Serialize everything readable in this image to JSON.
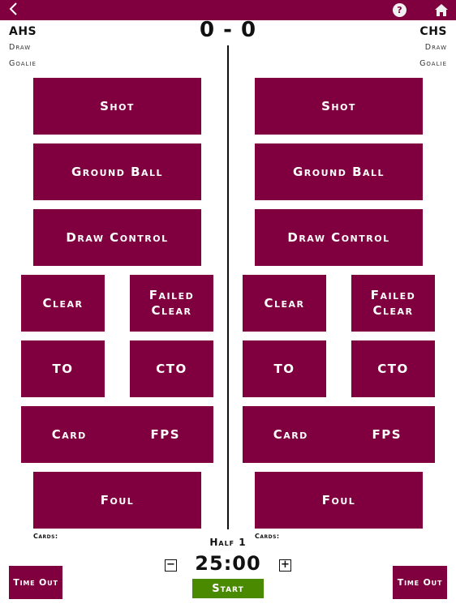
{
  "header": {
    "back_icon": "chevron-left-icon",
    "help_icon": "question-bubble-icon",
    "help_glyph": "?",
    "home_icon": "home-icon",
    "bar_color": "#80003f"
  },
  "scoreboard": {
    "home_team": "AHS",
    "away_team": "CHS",
    "score": "0 - 0",
    "home_draw": "Draw",
    "home_goalie": "Goalie",
    "away_draw": "Draw",
    "away_goalie": "Goalie"
  },
  "left": {
    "shot": "Shot",
    "ground_ball": "Ground Ball",
    "draw_control": "Draw Control",
    "clear": "Clear",
    "failed_clear": "Failed Clear",
    "to": "TO",
    "cto": "CTO",
    "card": "Card",
    "fps": "FPS",
    "foul": "Foul",
    "cards_label": "Cards:"
  },
  "right": {
    "shot": "Shot",
    "ground_ball": "Ground Ball",
    "draw_control": "Draw Control",
    "clear": "Clear",
    "failed_clear": "Failed Clear",
    "to": "TO",
    "cto": "CTO",
    "card": "Card",
    "fps": "FPS",
    "foul": "Foul",
    "cards_label": "Cards:"
  },
  "clock": {
    "period": "Half 1",
    "time": "25:00",
    "minus": "−",
    "plus": "+",
    "start": "Start",
    "start_color": "#4a8a00"
  },
  "timeouts": {
    "left": "Time Out",
    "right": "Time Out"
  },
  "colors": {
    "button": "#80003f"
  }
}
